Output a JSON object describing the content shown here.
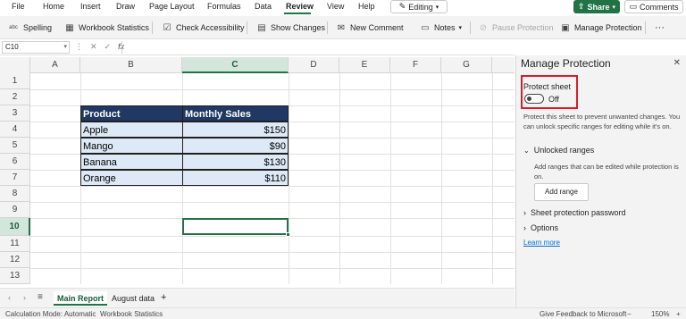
{
  "menu": {
    "items": [
      "File",
      "Home",
      "Insert",
      "Draw",
      "Page Layout",
      "Formulas",
      "Data",
      "Review",
      "View",
      "Help"
    ],
    "active": "Review",
    "editing_label": "Editing",
    "share_label": "Share",
    "comments_label": "Comments"
  },
  "ribbon": {
    "spelling": "Spelling",
    "workbook_statistics": "Workbook Statistics",
    "check_accessibility": "Check Accessibility",
    "show_changes": "Show Changes",
    "new_comment": "New Comment",
    "notes": "Notes",
    "pause_protection": "Pause Protection",
    "manage_protection": "Manage Protection",
    "more": "···",
    "spelling_icon_text": "abc"
  },
  "formula_bar": {
    "name_box": "C10",
    "fx": "fx",
    "value": ""
  },
  "grid": {
    "columns": [
      "A",
      "B",
      "C",
      "D",
      "E",
      "F",
      "G"
    ],
    "rows": [
      "1",
      "2",
      "3",
      "4",
      "5",
      "6",
      "7",
      "8",
      "9",
      "10",
      "11",
      "12",
      "13"
    ],
    "selected_column": "C",
    "selected_row": "10",
    "table": {
      "headers": [
        "Product",
        "Monthly Sales"
      ],
      "rows": [
        [
          "Apple",
          "$150"
        ],
        [
          "Mango",
          "$90"
        ],
        [
          "Banana",
          "$130"
        ],
        [
          "Orange",
          "$110"
        ]
      ]
    }
  },
  "sheets": {
    "tabs": [
      "Main Report",
      "August data"
    ],
    "active": "Main Report",
    "add": "+"
  },
  "status": {
    "calc_mode": "Calculation Mode: Automatic",
    "workbook_stats": "Workbook Statistics",
    "feedback": "Give Feedback to Microsoft",
    "zoom": "150%"
  },
  "pane": {
    "title": "Manage Protection",
    "protect_sheet_label": "Protect sheet",
    "toggle_state": "Off",
    "protect_description": "Protect this sheet to prevent unwanted changes. You can unlock specific ranges for editing while it's on.",
    "unlocked_ranges": "Unlocked ranges",
    "unlocked_description": "Add ranges that can be edited while protection is on.",
    "add_range": "Add range",
    "sheet_password": "Sheet protection password",
    "options": "Options",
    "learn_more": "Learn more"
  },
  "colors": {
    "accent": "#217346",
    "table_header": "#1f3864",
    "table_row": "#dde9f6",
    "highlight_box": "#e0192a"
  }
}
